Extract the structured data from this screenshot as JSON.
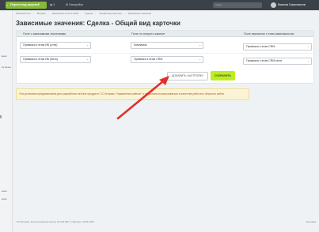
{
  "topbar": {
    "portal_button": "Портал под защитой",
    "item_count": "4",
    "settings": "Настройки",
    "search_placeholder": "поиск...",
    "user_name": "Максим Самохвалов"
  },
  "sidebar": {
    "items": [
      "ания",
      "ое меню",
      "ение",
      "ания"
    ]
  },
  "breadcrumb": [
    "Рабочий стол",
    "Битрикс",
    "Зависимые поля в CRM",
    "Сделка",
    "Общий вид карточки",
    "Зависимые значения"
  ],
  "page": {
    "title": "Зависимые значения: Сделка - Общий вид карточки"
  },
  "table": {
    "headers": [
      "Поле с зависимыми значениями",
      "Поле от которого зависит",
      "Поле связанное с этим зависимостью"
    ],
    "rows": [
      [
        "Привязка к этим ИБ (стек)",
        "Компания",
        "Привязка к этим CRM"
      ],
      [
        "Привязка к этим ИБ (блок)",
        "Привязка к этим CRM",
        "Привязка к этим CRM иное"
      ]
    ]
  },
  "buttons": {
    "add_settings": "ДОБАВИТЬ НАСТРОЙКУ",
    "save": "СОХРАНИТЬ"
  },
  "warning": {
    "text": "Эта установка предназначена для разработки на базе продукта \"1С-Битрикс: Управление сайтом\" и не должна использоваться в качестве рабочего сборного сайта."
  },
  "footer": {
    "left": "\"1С-Битрикс: Корпоративный портал 24.100.300. © Битрикс, 2002-2024",
    "right": "Реклама"
  },
  "colors": {
    "save_button": "#bbed21",
    "portal_button": "#86b93a",
    "arrow": "#e1302a"
  }
}
